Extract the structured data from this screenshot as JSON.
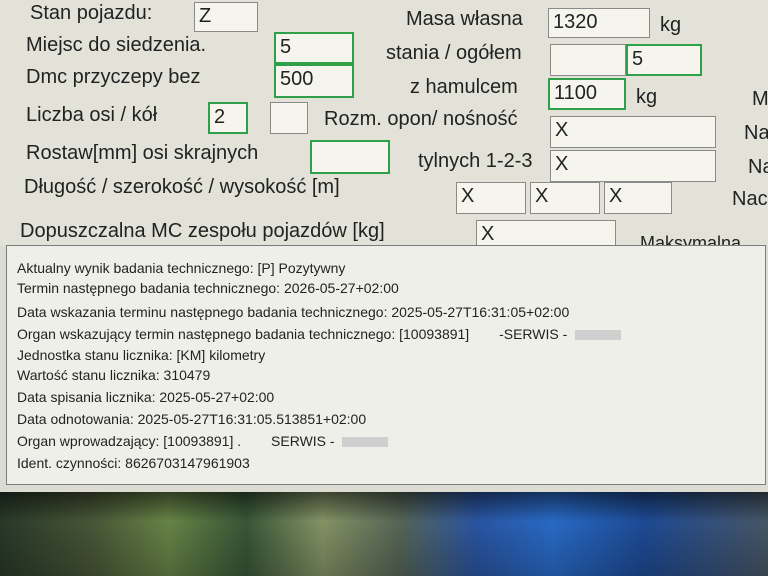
{
  "form": {
    "stan_label": "Stan pojazdu:",
    "stan_value": "Z",
    "masa_label": "Masa własna",
    "masa_value": "1320",
    "masa_unit": "kg",
    "miejsc_label": "Miejsc do siedzenia.",
    "miejsc_value": "5",
    "stania_label": "stania / ogółem",
    "stania_value": "",
    "ogolem_value": "5",
    "dmc_label": "Dmc przyczepy bez",
    "dmc_value": "500",
    "z_hamulcem_label": "z hamulcem",
    "z_hamulcem_value": "1100",
    "z_hamulcem_unit": "kg",
    "right_cut_1": "M",
    "osi_label": "Liczba osi / kół",
    "osi_value": "2",
    "kol_value": "",
    "opon_label": "Rozm. opon/ nośność",
    "opon_value": "X",
    "right_cut_2": "Na",
    "rostaw_label": "Rostaw[mm] osi skrajnych",
    "rostaw_value": "",
    "tylnych_label": "tylnych 1-2-3",
    "tylnych_value": "X",
    "right_cut_3": "Na",
    "dlugosc_label": "Długość / szerokość / wysokość [m]",
    "dlugosc_value": "X",
    "szerokosc_value": "X",
    "wysokosc_value": "X",
    "right_cut_4": "Nac",
    "mc_label": "Dopuszczalna MC zespołu pojazdów [kg]",
    "mc_value": "X",
    "maks_label": "Maksymalna"
  },
  "log": {
    "lines": [
      "Aktualny wynik badania technicznego: [P] Pozytywny",
      "Termin następnego badania technicznego: 2026-05-27+02:00",
      "Data wskazania terminu następnego badania technicznego: 2025-05-27T16:31:05+02:00",
      "Organ wskazujący termin następnego badania technicznego: [10093891]",
      "Jednostka stanu licznika: [KM] kilometry",
      "Wartość stanu licznika: 310479",
      "Data spisania licznika: 2025-05-27+02:00",
      "Data odnotowania: 2025-05-27T16:31:05.513851+02:00",
      "Organ wprowadzający: [10093891] .",
      "Ident. czynności: 8626703147961903"
    ],
    "serwis_1": "-SERWIS -",
    "serwis_2": "SERWIS -"
  }
}
